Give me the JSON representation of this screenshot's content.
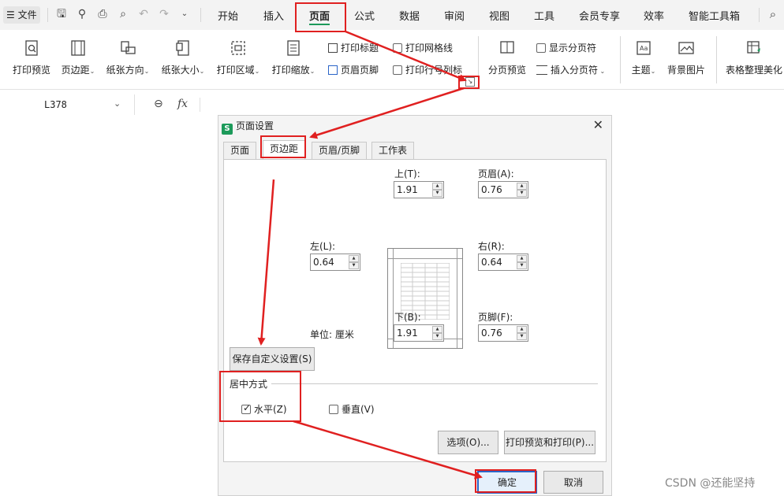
{
  "menubar": {
    "file_label": "文件",
    "tabs": [
      "开始",
      "插入",
      "页面",
      "公式",
      "数据",
      "审阅",
      "视图",
      "工具",
      "会员专享",
      "效率",
      "智能工具箱"
    ],
    "active_tab": "页面"
  },
  "ribbon": {
    "print_preview": "打印预览",
    "margins": "页边距",
    "orientation": "纸张方向",
    "paper_size": "纸张大小",
    "print_area": "打印区域",
    "print_scale": "打印缩放",
    "print_titles": "打印标题",
    "header_footer": "页眉页脚",
    "print_gridlines": "打印网格线",
    "print_row_col": "打印行号列标",
    "page_break_preview": "分页预览",
    "show_page_breaks": "显示分页符",
    "insert_page_break": "插入分页符",
    "theme": "主题",
    "background": "背景图片",
    "table_beautify": "表格整理美化"
  },
  "formulabar": {
    "cell_ref": "L378",
    "fx": "fx"
  },
  "dialog": {
    "title": "页面设置",
    "app_icon": "S",
    "tabs": [
      "页面",
      "页边距",
      "页眉/页脚",
      "工作表"
    ],
    "active_tab": "页边距",
    "top_label": "上(T):",
    "top_value": "1.91",
    "header_label": "页眉(A):",
    "header_value": "0.76",
    "left_label": "左(L):",
    "left_value": "0.64",
    "right_label": "右(R):",
    "right_value": "0.64",
    "bottom_label": "下(B):",
    "bottom_value": "1.91",
    "footer_label": "页脚(F):",
    "footer_value": "0.76",
    "unit_label": "单位: 厘米",
    "save_custom": "保存自定义设置(S)",
    "center_group": "居中方式",
    "horizontal": "水平(Z)",
    "horizontal_checked": true,
    "vertical": "垂直(V)",
    "vertical_checked": false,
    "options": "选项(O)...",
    "print_preview": "打印预览和打印(P)...",
    "ok": "确定",
    "cancel": "取消"
  },
  "colors": {
    "annotation_red": "#e02020",
    "accent_green": "#1c9a5a",
    "primary_blue": "#2a64c8"
  },
  "watermark": "CSDN @还能坚持"
}
